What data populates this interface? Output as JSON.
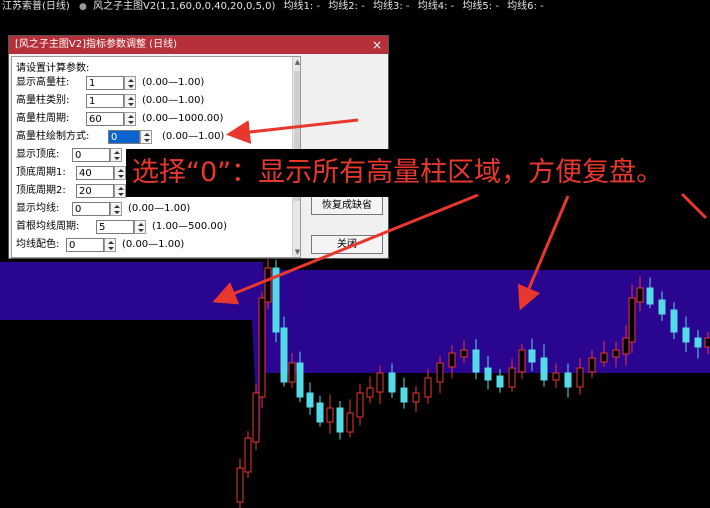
{
  "topbar": {
    "symbol": "江苏索普(日线)",
    "indicator": "风之子主图V2(1,1,60,0,0,40,20,0,5,0)",
    "ma_labels": [
      "均线1: -",
      "均线2: -",
      "均线3: -",
      "均线4: -",
      "均线5: -",
      "均线6: -"
    ]
  },
  "dialog": {
    "title": "[风之子主图V2]指标参数调整 (日线)",
    "close_glyph": "×",
    "prompt": "请设置计算参数:",
    "params": [
      {
        "label": "显示高量柱:",
        "value": "1",
        "range": "(0.00—1.00)"
      },
      {
        "label": "高量柱类别:",
        "value": "1",
        "range": "(0.00—1.00)"
      },
      {
        "label": "高量柱周期:",
        "value": "60",
        "range": "(0.00—1000.00)"
      },
      {
        "label": "高量柱绘制方式:",
        "value": "0",
        "range": "(0.00—1.00)"
      },
      {
        "label": "显示顶底:",
        "value": "0",
        "range": ""
      },
      {
        "label": "顶底周期1:",
        "value": "40",
        "range": ""
      },
      {
        "label": "顶底周期2:",
        "value": "20",
        "range": ""
      },
      {
        "label": "显示均线:",
        "value": "0",
        "range": "(0.00—1.00)"
      },
      {
        "label": "首根均线周期:",
        "value": "5",
        "range": "(1.00—500.00)"
      },
      {
        "label": "均线配色:",
        "value": "0",
        "range": "(0.00—1.00)"
      }
    ],
    "restore_label": "恢复成缺省",
    "close_label": "关闭"
  },
  "annotation": {
    "text": "选择“0”：显示所有高量柱区域，方便复盘。",
    "color": "#e8382e"
  },
  "colors": {
    "band": "#2a0590",
    "up_candle": "#e8382e",
    "down_candle": "#55dbe8",
    "arrow": "#e8382e"
  }
}
